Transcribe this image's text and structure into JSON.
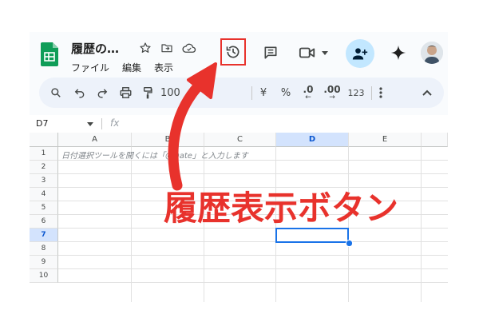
{
  "header": {
    "doc_title": "履歴の…",
    "menu": [
      "ファイル",
      "編集",
      "表示"
    ]
  },
  "toolbar": {
    "zoom": "100",
    "currency": "¥",
    "percent": "%",
    "dec_decrease": ".0",
    "dec_increase": ".00",
    "number_format": "123"
  },
  "formula_bar": {
    "cell_ref": "D7",
    "fx": "fx"
  },
  "sheet": {
    "columns": [
      "A",
      "B",
      "C",
      "D",
      "E"
    ],
    "rows": [
      "1",
      "2",
      "3",
      "4",
      "5",
      "6",
      "7",
      "8",
      "9",
      "10"
    ],
    "selected_cell": "D7",
    "row1_text": "日付選択ツールを開くには「@Date」と入力します"
  },
  "annotation": {
    "label": "履歴表示ボタン",
    "color": "#e8322c"
  },
  "colors": {
    "sheets_green": "#0f9d58",
    "toolbar_bg": "#edf2fa",
    "share_bg": "#c2e7ff",
    "selection_blue": "#1a73e8"
  }
}
